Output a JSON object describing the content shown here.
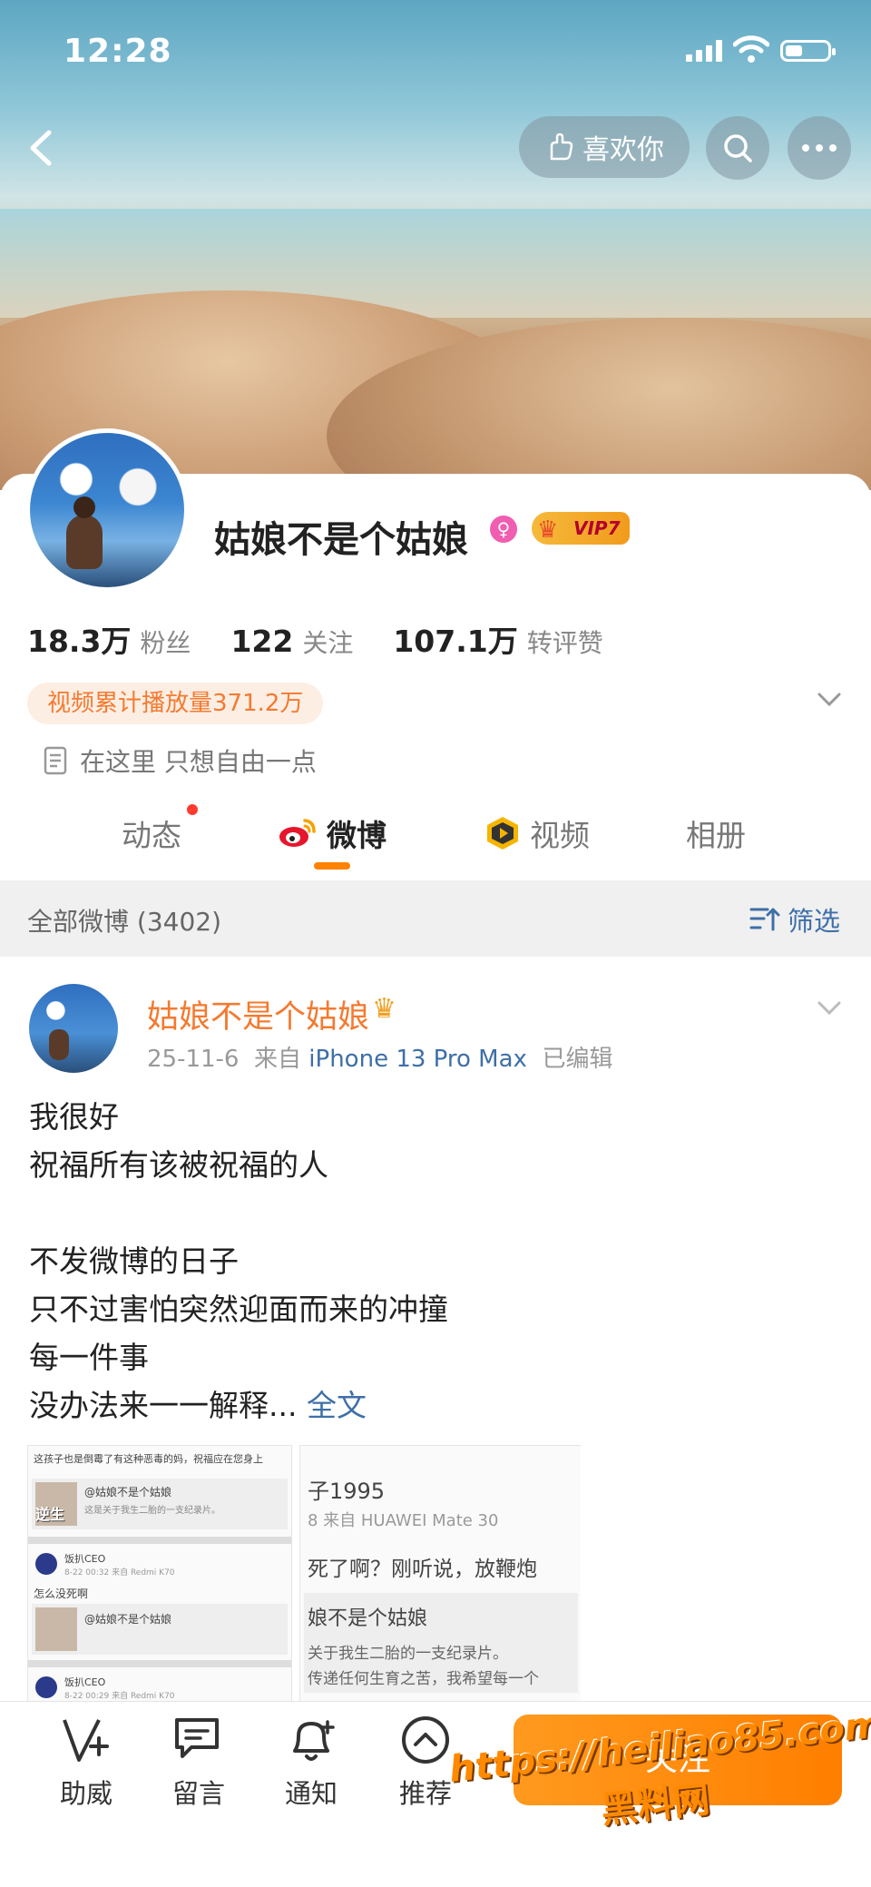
{
  "status_bar": {
    "time": "12:28"
  },
  "header": {
    "like_label": "喜欢你"
  },
  "profile": {
    "name": "姑娘不是个姑娘",
    "vip_label": "VIP7",
    "stats": [
      {
        "value": "18.3万",
        "label": "粉丝"
      },
      {
        "value": "122",
        "label": "关注"
      },
      {
        "value": "107.1万",
        "label": "转评赞"
      }
    ],
    "video_plays": "视频累计播放量371.2万",
    "bio": "在这里 只想自由一点"
  },
  "tabs": [
    {
      "label": "动态"
    },
    {
      "label": "微博"
    },
    {
      "label": "视频"
    },
    {
      "label": "相册"
    }
  ],
  "filter_bar": {
    "count_label": "全部微博 (3402)",
    "filter_label": "筛选"
  },
  "post": {
    "author": "姑娘不是个姑娘",
    "date": "25-11-6",
    "source_prefix": "来自",
    "source": "iPhone 13 Pro Max",
    "edited": "已编辑",
    "text": "我很好\n祝福所有该被祝福的人\n\n不发微博的日子\n只不过害怕突然迎面而来的冲撞\n每一件事\n没办法来一一解释...",
    "full_text_label": "全文",
    "image1": {
      "line1": "这孩子也是倒霉了有这种恶毒的妈，祝福应在您身上",
      "quote1": "@姑娘不是个姑娘",
      "quote1_sub": "这是关于我生二胎的一支纪录片。",
      "user1": "饭扒CEO",
      "user1_meta": "8-22 00:32  来自 Redmi K70",
      "line2": "怎么没死啊",
      "quote2": "@姑娘不是个姑娘",
      "user2": "饭扒CEO",
      "user2_meta": "8-22 00:29  来自 Redmi K70",
      "sticker": "逆生"
    },
    "image2": {
      "user": "子1995",
      "meta": "8  来自 HUAWEI Mate 30",
      "comment": "死了啊？刚听说，放鞭炮",
      "quote": "娘不是个姑娘",
      "quote_sub1": "关于我生二胎的一支纪录片。",
      "quote_sub2": "传递任何生育之苦，我希望每一个"
    }
  },
  "bottom_bar": {
    "items": [
      {
        "label": "助威"
      },
      {
        "label": "留言"
      },
      {
        "label": "通知"
      },
      {
        "label": "推荐"
      }
    ],
    "follow_label": "关注"
  },
  "watermark": {
    "url": "https://heiliao85.com",
    "name": "黑料网"
  }
}
